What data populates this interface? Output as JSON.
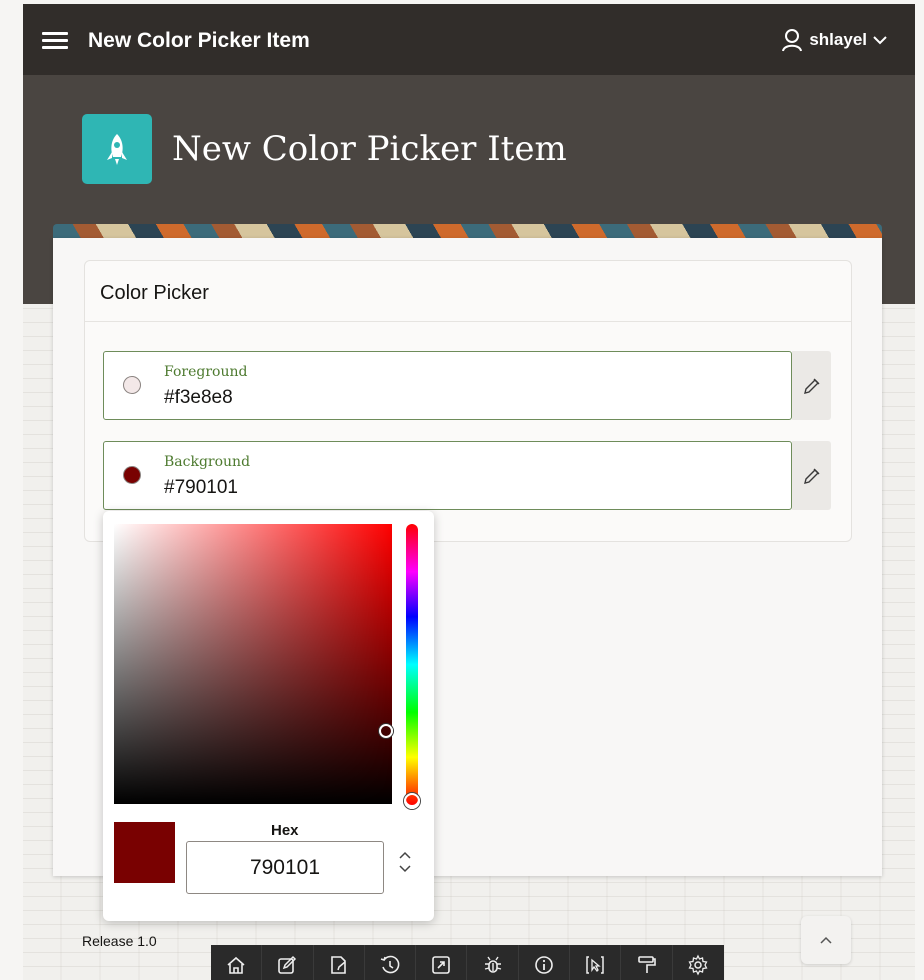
{
  "topbar": {
    "menu_icon": "hamburger-icon",
    "app_title": "New Color Picker Item",
    "user": {
      "name": "shlayel",
      "icon": "person-icon",
      "chevron": "chevron-down-icon"
    }
  },
  "hero": {
    "icon": "rocket-icon",
    "icon_color": "#2fb6b4",
    "page_title": "New Color Picker Item"
  },
  "region": {
    "title": "Color Picker",
    "items": [
      {
        "label": "Foreground",
        "value": "#f3e8e8",
        "swatch_color": "#f3e8e8",
        "picker_icon": "eyedropper-icon"
      },
      {
        "label": "Background",
        "value": "#790101",
        "swatch_color": "#790101",
        "picker_icon": "eyedropper-icon"
      }
    ]
  },
  "color_popup": {
    "hue": "#ff0000",
    "selected_color": "#790101",
    "hex_label": "Hex",
    "hex_value": "790101",
    "mode_toggle_icon": "up-down-chevron-icon"
  },
  "footer": {
    "release": "Release 1.0",
    "scroll_top_icon": "chevron-up-icon"
  },
  "developer_toolbar": [
    {
      "icon": "home-icon"
    },
    {
      "icon": "edit-page-icon"
    },
    {
      "icon": "session-icon"
    },
    {
      "icon": "history-icon"
    },
    {
      "icon": "open-external-icon"
    },
    {
      "icon": "debug-icon"
    },
    {
      "icon": "info-icon"
    },
    {
      "icon": "quick-edit-icon"
    },
    {
      "icon": "theme-roller-icon"
    },
    {
      "icon": "settings-icon"
    }
  ]
}
